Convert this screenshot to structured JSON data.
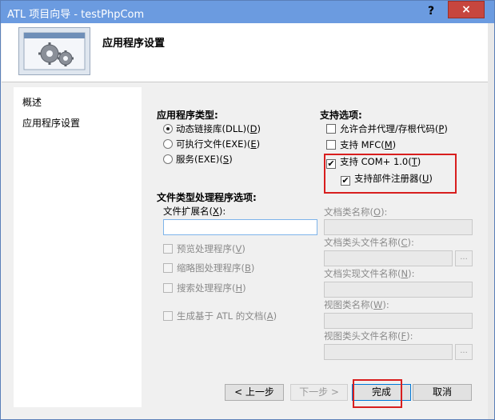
{
  "window": {
    "title": "ATL 项目向导 - testPhpCom",
    "help_label": "?",
    "close_label": "×"
  },
  "header": {
    "title": "应用程序设置"
  },
  "nav": {
    "items": [
      {
        "label": "概述"
      },
      {
        "label": "应用程序设置"
      }
    ]
  },
  "app_type": {
    "title": "应用程序类型:",
    "options": [
      {
        "text": "动态链接库(DLL)(",
        "key": "D",
        "close": ")",
        "selected": true
      },
      {
        "text": "可执行文件(EXE)(",
        "key": "E",
        "close": ")",
        "selected": false
      },
      {
        "text": "服务(EXE)(",
        "key": "S",
        "close": ")",
        "selected": false
      }
    ]
  },
  "support": {
    "title": "支持选项:",
    "options": [
      {
        "text": "允许合并代理/存根代码(",
        "key": "P",
        "close": ")",
        "checked": false
      },
      {
        "text": "支持 MFC(",
        "key": "M",
        "close": ")",
        "checked": false
      },
      {
        "text": "支持 COM+ 1.0(",
        "key": "T",
        "close": ")",
        "checked": true
      },
      {
        "text": "支持部件注册器(",
        "key": "U",
        "close": ")",
        "checked": true
      }
    ],
    "check_mark": "✔"
  },
  "file_handler": {
    "title": "文件类型处理程序选项:",
    "ext_label": "文件扩展名(",
    "ext_key": "X",
    "ext_close": "):",
    "ext_value": "",
    "options": [
      {
        "text": "预览处理程序(",
        "key": "V",
        "close": ")"
      },
      {
        "text": "缩略图处理程序(",
        "key": "B",
        "close": ")"
      },
      {
        "text": "搜索处理程序(",
        "key": "H",
        "close": ")"
      },
      {
        "text": "生成基于 ATL 的文档(",
        "key": "A",
        "close": ")"
      }
    ]
  },
  "doc_fields": [
    {
      "label": "文档类名称(",
      "key": "O",
      "close": "):",
      "has_browse": false
    },
    {
      "label": "文档类头文件名称(",
      "key": "C",
      "close": "):",
      "has_browse": true
    },
    {
      "label": "文档实现文件名称(",
      "key": "N",
      "close": "):",
      "has_browse": false
    },
    {
      "label": "视图类名称(",
      "key": "W",
      "close": "):",
      "has_browse": false
    },
    {
      "label": "视图类头文件名称(",
      "key": "F",
      "close": "):",
      "has_browse": true
    }
  ],
  "browse_label": "...",
  "buttons": {
    "prev": "< 上一步",
    "next": "下一步 >",
    "finish": "完成",
    "cancel": "取消"
  }
}
